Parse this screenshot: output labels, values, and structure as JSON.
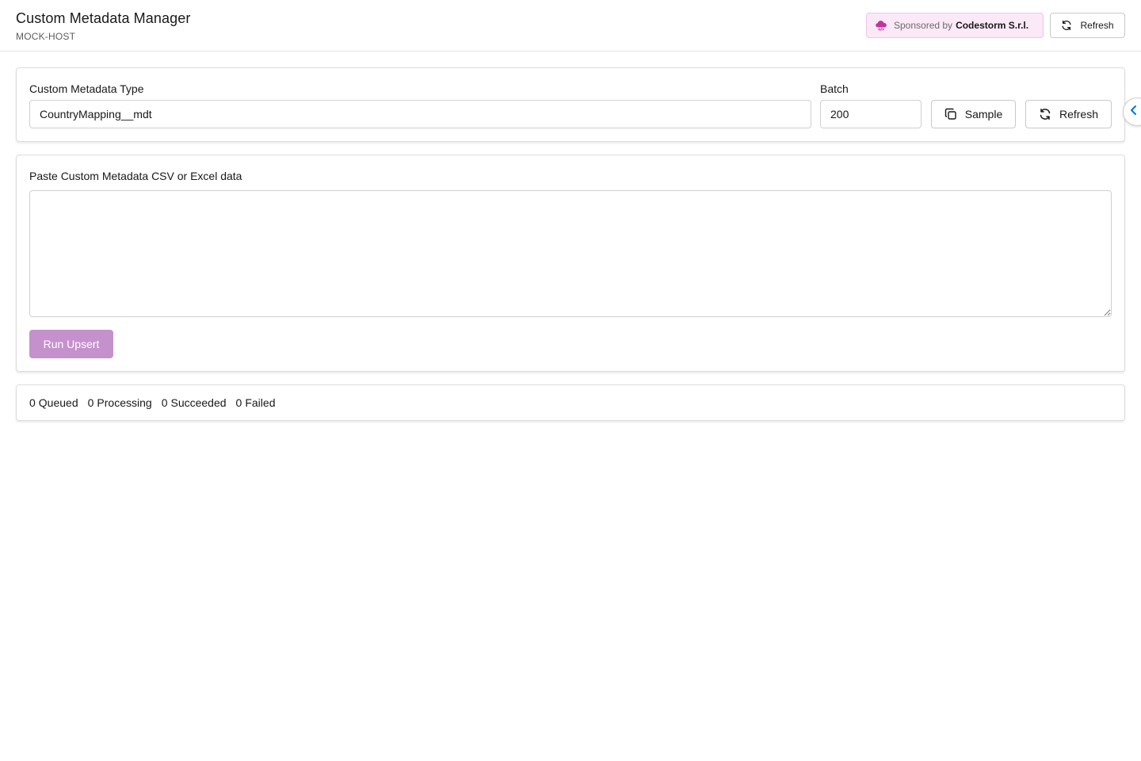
{
  "header": {
    "title": "Custom Metadata Manager",
    "subtitle": "MOCK-HOST",
    "sponsor": {
      "prefix": "Sponsored by",
      "name": "Codestorm S.r.l.",
      "icon": "cloud-code-icon",
      "accent_color": "#c3339f"
    },
    "refresh_label": "Refresh"
  },
  "config": {
    "type_label": "Custom Metadata Type",
    "type_value": "CountryMapping__mdt",
    "batch_label": "Batch",
    "batch_value": "200",
    "sample_label": "Sample",
    "refresh_label": "Refresh"
  },
  "paste": {
    "label": "Paste Custom Metadata CSV or Excel data",
    "value": "",
    "run_label": "Run Upsert",
    "run_disabled": true,
    "run_color": "#c591cc"
  },
  "status": {
    "queued": {
      "count": "0",
      "label": "Queued"
    },
    "processing": {
      "count": "0",
      "label": "Processing"
    },
    "succeeded": {
      "count": "0",
      "label": "Succeeded"
    },
    "failed": {
      "count": "0",
      "label": "Failed"
    }
  },
  "side_panel": {
    "toggle_icon": "chevron-left-icon",
    "accent_color": "#0176d3"
  }
}
